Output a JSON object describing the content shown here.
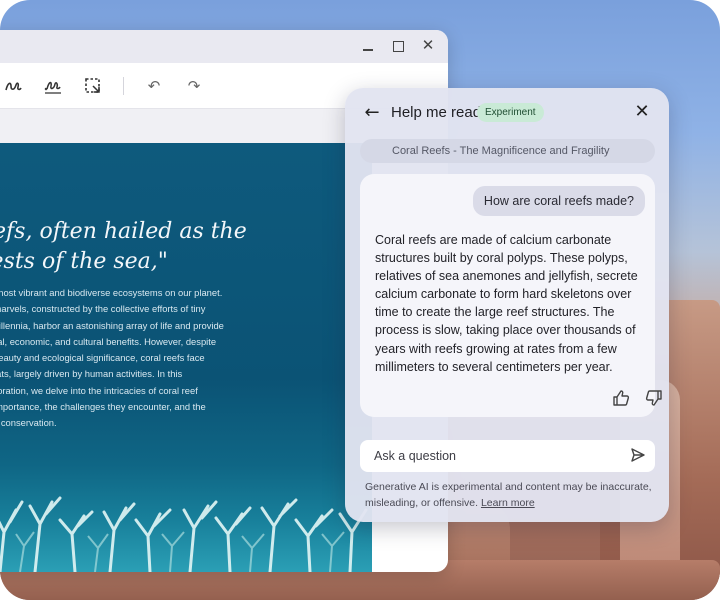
{
  "article": {
    "quote_lines": [
      "eefs, often hailed as the",
      "rests of the sea,\""
    ],
    "body_lines": [
      "the most vibrant and biodiverse ecosystems on our planet.",
      "ter marvels, constructed by the collective efforts of tiny",
      "er millennia, harbor an astonishing array of life and provide",
      "ogical, economic, and cultural benefits. However, despite",
      "ng beauty and ecological significance, coral reefs face",
      " threats, largely driven by human activities. In this",
      " exploration, we delve into the intricacies of coral reef",
      "eir importance, the challenges they encounter, and the",
      " their conservation."
    ]
  },
  "panel": {
    "title": "Help me read",
    "badge": "Experiment",
    "source_title": "Coral Reefs - The Magnificence and Fragility",
    "user_question": "How are coral reefs made?",
    "answer_lines": [
      "Coral reefs are made of calcium carbonate",
      "structures built by coral polyps. These polyps,",
      "relatives of sea anemones and jellyfish, secrete",
      "calcium carbonate to form hard skeletons over",
      "time to create the large reef structures. The",
      "process is slow, taking place over thousands of",
      "years with reefs growing at rates from a few",
      "millimeters to several centimeters per year."
    ],
    "ask_placeholder": "Ask a question",
    "disclaimer": "Generative AI is experimental and content may be inaccurate, misleading, or offensive.",
    "learn_more": "Learn more"
  },
  "icons": {
    "toolbar": [
      "draw-icon",
      "signature-icon",
      "select-region-icon",
      "undo-icon",
      "redo-icon"
    ],
    "window": [
      "minimize-icon",
      "maximize-icon",
      "close-icon"
    ],
    "panel": [
      "back-arrow-icon",
      "close-icon",
      "thumbs-up-icon",
      "thumbs-down-icon",
      "send-icon"
    ]
  },
  "colors": {
    "article_bg": "#0b5375",
    "badge_bg": "#c9ead6",
    "panel_bg": "#e2e4f0"
  }
}
